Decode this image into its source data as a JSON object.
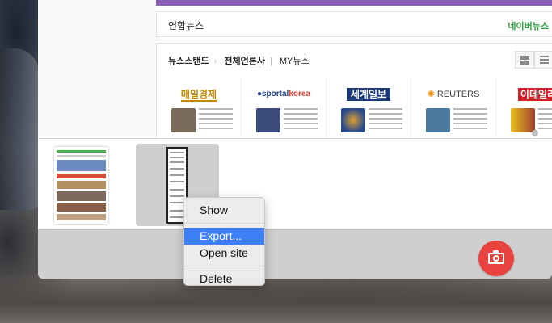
{
  "website": {
    "section_title": "연합뉴스",
    "section_link": "네이버뉴스",
    "newsstand": {
      "tabs": [
        "뉴스스탠드",
        "전체언론사",
        "MY뉴스"
      ],
      "view_buttons": [
        "grid-view",
        "list-view"
      ],
      "papers": [
        {
          "name": "매일경제",
          "thumb_color": "#7a6a5a"
        },
        {
          "name": "sportalkorea",
          "prefix": "●sportal",
          "suffix": "korea",
          "thumb_color": "#3a4a7a"
        },
        {
          "name": "세계일보",
          "thumb_color": "#284a8a"
        },
        {
          "name": "REUTERS",
          "thumb_color": "#4a7aa0"
        },
        {
          "name": "이데일리",
          "thumb_color": "#a04030"
        }
      ]
    }
  },
  "thumbnails": [
    {
      "label": "screenshot-1"
    },
    {
      "label": "screenshot-2",
      "selected": true
    }
  ],
  "context_menu": {
    "items": [
      "Show",
      "Export...",
      "Open site",
      "Delete"
    ],
    "highlighted": "Export..."
  },
  "colors": {
    "accent_purple": "#8b5fb5",
    "camera_button": "#e8423f",
    "menu_highlight": "#3d7ff5",
    "naver_green": "#2a9d3b"
  }
}
